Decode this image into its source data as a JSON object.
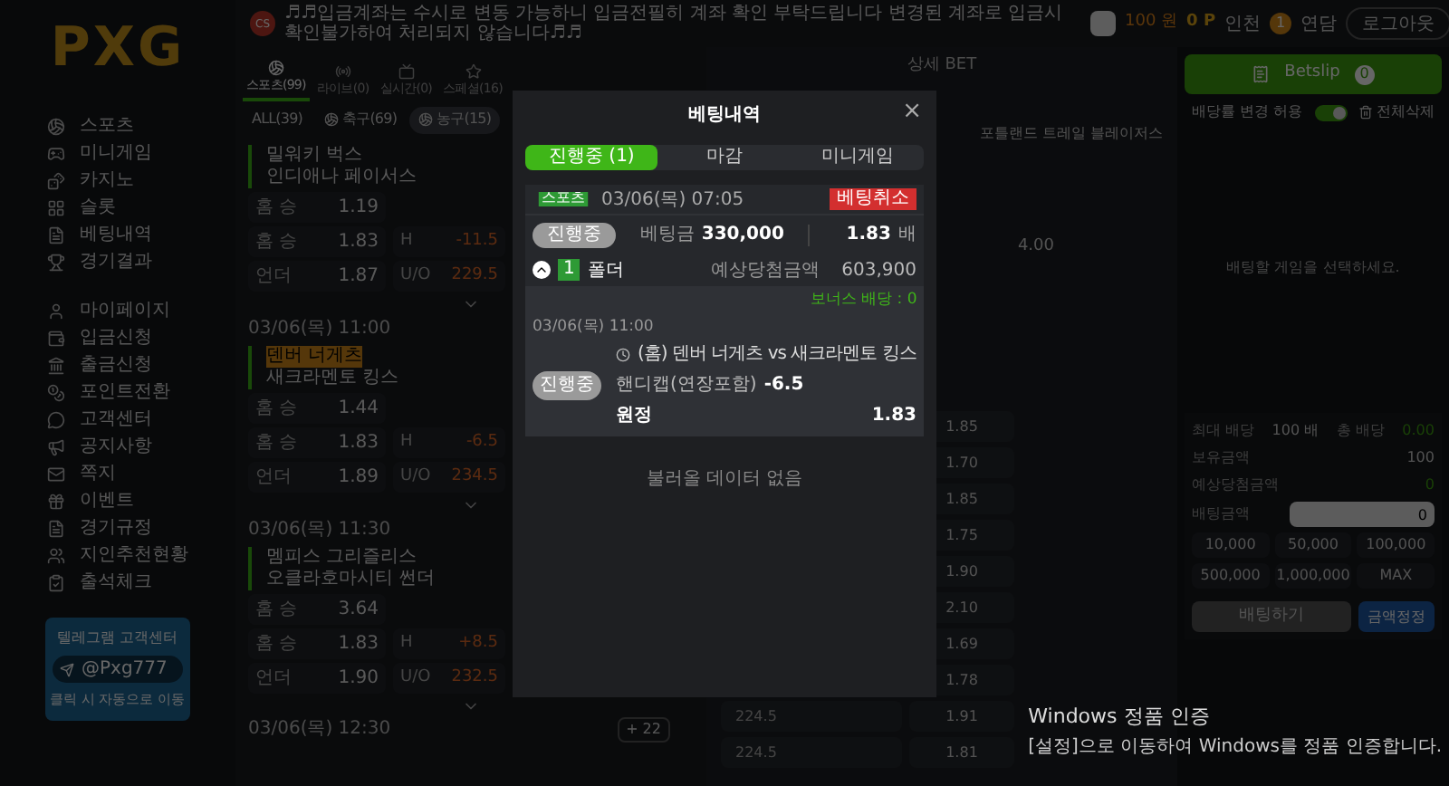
{
  "sidebar": {
    "logo": "PXG",
    "menu_groups": [
      [
        {
          "label": "스포츠"
        },
        {
          "label": "미니게임"
        },
        {
          "label": "카지노"
        },
        {
          "label": "슬롯"
        },
        {
          "label": "베팅내역"
        },
        {
          "label": "경기결과"
        }
      ],
      [
        {
          "label": "마이페이지"
        },
        {
          "label": "입금신청"
        },
        {
          "label": "출금신청"
        },
        {
          "label": "포인트전환"
        },
        {
          "label": "고객센터"
        },
        {
          "label": "공지사항"
        },
        {
          "label": "쪽지"
        },
        {
          "label": "이벤트"
        },
        {
          "label": "경기규정"
        },
        {
          "label": "지인추천현황"
        },
        {
          "label": "출석체크"
        }
      ]
    ],
    "telegram": {
      "title": "텔레그램 고객센터",
      "handle": "@Pxg777",
      "hint": "클릭 시 자동으로 이동"
    }
  },
  "notice": {
    "badge": "CS",
    "text": "♬♬입금계좌는 수시로 변동 가능하니 입금전필히 계좌 확인 부탁드립니다 변경된 계좌로 입금시 확인불가하여 처리되지 않습니다♬♬"
  },
  "header": {
    "money": "100 원",
    "point": "0 P",
    "user": "인천",
    "level": "1",
    "grade": "연담",
    "logout": "로그아웃"
  },
  "sport_tabs": [
    {
      "label": "스포츠(99)",
      "selected": true
    },
    {
      "label": "라이브(0)",
      "selected": false
    },
    {
      "label": "실시간(0)",
      "selected": false
    },
    {
      "label": "스페셜(16)",
      "selected": false
    }
  ],
  "filters": [
    {
      "label": "ALL(39)",
      "selected": false
    },
    {
      "label": "축구(69)",
      "selected": false
    },
    {
      "label": "농구(15)",
      "selected": true
    }
  ],
  "games": [
    {
      "teams": [
        {
          "name": "밀워키 벅스",
          "highlighted": false
        },
        {
          "name": "인디애나 페이서스",
          "highlighted": false
        }
      ],
      "rows": [
        {
          "label": "홈 승",
          "odds": "1.19"
        },
        {
          "label": "홈 승",
          "odds": "1.83",
          "market": "H",
          "line": "-11.5"
        },
        {
          "label": "언더",
          "odds": "1.87",
          "market": "U/O",
          "line": "229.5"
        }
      ]
    },
    {
      "date": "03/06(목) 11:00",
      "teams": [
        {
          "name": "덴버 너게츠",
          "highlighted": true
        },
        {
          "name": "새크라멘토 킹스",
          "highlighted": false
        }
      ],
      "rows": [
        {
          "label": "홈 승",
          "odds": "1.44"
        },
        {
          "label": "홈 승",
          "odds": "1.83",
          "market": "H",
          "line": "-6.5"
        },
        {
          "label": "언더",
          "odds": "1.89",
          "market": "U/O",
          "line": "234.5"
        }
      ]
    },
    {
      "date": "03/06(목) 11:30",
      "teams": [
        {
          "name": "멤피스 그리즐리스",
          "highlighted": false
        },
        {
          "name": "오클라호마시티 썬더",
          "highlighted": false
        }
      ],
      "rows": [
        {
          "label": "홈 승",
          "odds": "3.64"
        },
        {
          "label": "홈 승",
          "odds": "1.83",
          "market": "H",
          "line": "+8.5"
        },
        {
          "label": "언더",
          "odds": "1.90",
          "market": "U/O",
          "line": "232.5"
        }
      ]
    }
  ],
  "next_date": "03/06(목) 12:30",
  "more": "+ 22",
  "detail": {
    "title": "상세 BET",
    "away_team": "포틀랜드 트레일 블레이저스",
    "top_odds": "4.00",
    "rows": [
      {
        "line": "",
        "value": "1.85"
      },
      {
        "line": "",
        "value": "1.70"
      },
      {
        "line": "",
        "value": "1.85"
      },
      {
        "line": "",
        "value": "1.75"
      },
      {
        "line": "",
        "value": "1.90"
      },
      {
        "line": "",
        "value": "2.10"
      },
      {
        "line": "",
        "value": "1.69"
      },
      {
        "line": "",
        "value": "1.78"
      },
      {
        "line": "224.5",
        "value": "1.91"
      },
      {
        "line": "224.5",
        "value": "1.81"
      }
    ]
  },
  "betslip": {
    "title": "Betslip",
    "count": "0",
    "allow_change": {
      "label": "배당률 변경 허용",
      "on": true
    },
    "clear": "전체삭제",
    "empty": "배팅할 게임을 선택하세요.",
    "stats": [
      {
        "label": "최대 배당",
        "value": "100 배",
        "label2": "총 배당",
        "value2": "0.00"
      },
      {
        "label": "보유금액",
        "value": "100"
      },
      {
        "label": "예상당첨금액",
        "value": "0"
      }
    ],
    "amount": {
      "label": "배팅금액",
      "value": "0"
    },
    "chips": [
      "10,000",
      "50,000",
      "100,000",
      "500,000",
      "1,000,000",
      "MAX"
    ],
    "bet": "배팅하기",
    "reset": "금액정정"
  },
  "modal": {
    "title": "베팅내역",
    "close": "×",
    "tabs": [
      {
        "label": "진행중 (1)",
        "selected": true
      },
      {
        "label": "마감",
        "selected": false
      },
      {
        "label": "미니게임",
        "selected": false
      }
    ],
    "bet": {
      "category": "스포츠",
      "time": "03/06(목) 07:05",
      "cancel": "베팅취소",
      "status": "진행중",
      "stake_label": "베팅금",
      "stake": "330,000",
      "odds": "1.83",
      "odds_unit": "배",
      "expanded": true,
      "folders": "1",
      "folder_label": "폴더",
      "win_label": "예상당첨금액",
      "win": "603,900",
      "bonus": "보너스 배당 : 0",
      "picks": [
        {
          "date": "03/06(목) 11:00",
          "status": "진행중",
          "match": "(홈) 덴버 너게츠 vs 새크라멘토 킹스",
          "market": "핸디캡(연장포함)",
          "line": "-6.5",
          "pick": "원정",
          "odds": "1.83"
        }
      ]
    },
    "footer": "불러올 데이터 없음"
  },
  "os_notice": {
    "title": "Windows 정품 인증",
    "text": "[설정]으로 이동하여 Windows를 정품 인증합니다."
  }
}
